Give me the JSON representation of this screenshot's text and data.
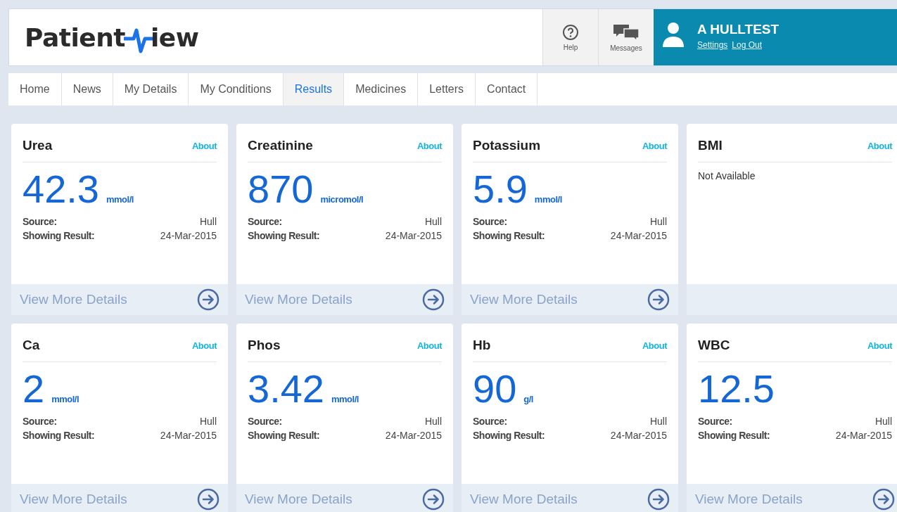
{
  "logo": {
    "before": "Patient",
    "after": "iew"
  },
  "header": {
    "help": "Help",
    "messages": "Messages",
    "user": {
      "name": "A HULLTEST",
      "links": [
        "Settings",
        "Log Out"
      ]
    }
  },
  "tabs": [
    {
      "label": "Home",
      "selected": false
    },
    {
      "label": "News",
      "selected": false
    },
    {
      "label": "My Details",
      "selected": false
    },
    {
      "label": "My Conditions",
      "selected": false
    },
    {
      "label": "Results",
      "selected": true
    },
    {
      "label": "Medicines",
      "selected": false
    },
    {
      "label": "Letters",
      "selected": false
    },
    {
      "label": "Contact",
      "selected": false
    }
  ],
  "cards": [
    {
      "kind": "result",
      "name": "Urea",
      "about": "About",
      "value": "42.3",
      "unit": "mmol/l",
      "source_label": "Source:",
      "source": "Hull",
      "date_label": "Showing Result:",
      "date": "24-Mar-2015",
      "link": "View More Details"
    },
    {
      "kind": "result",
      "name": "Creatinine",
      "about": "About",
      "value": "870",
      "unit": "micromol/l",
      "source_label": "Source:",
      "source": "Hull",
      "date_label": "Showing Result:",
      "date": "24-Mar-2015",
      "link": "View More Details"
    },
    {
      "kind": "result",
      "name": "Potassium",
      "about": "About",
      "value": "5.9",
      "unit": "mmol/l",
      "source_label": "Source:",
      "source": "Hull",
      "date_label": "Showing Result:",
      "date": "24-Mar-2015",
      "link": "View More Details"
    },
    {
      "kind": "unavailable",
      "name": "BMI",
      "about": "About",
      "message": "Not Available"
    },
    {
      "kind": "result",
      "name": "Ca",
      "about": "About",
      "value": "2",
      "unit": "mmol/l",
      "source_label": "Source:",
      "source": "Hull",
      "date_label": "Showing Result:",
      "date": "24-Mar-2015",
      "link": "View More Details"
    },
    {
      "kind": "result",
      "name": "Phos",
      "about": "About",
      "value": "3.42",
      "unit": "mmol/l",
      "source_label": "Source:",
      "source": "Hull",
      "date_label": "Showing Result:",
      "date": "24-Mar-2015",
      "link": "View More Details"
    },
    {
      "kind": "result",
      "name": "Hb",
      "about": "About",
      "value": "90",
      "unit": "g/l",
      "source_label": "Source:",
      "source": "Hull",
      "date_label": "Showing Result:",
      "date": "24-Mar-2015",
      "link": "View More Details"
    },
    {
      "kind": "result",
      "name": "WBC",
      "about": "About",
      "value": "12.5",
      "source_label": "Source:",
      "source": "Hull",
      "date_label": "Showing Result:",
      "date": "24-Mar-2015",
      "link": "View More Details"
    }
  ]
}
